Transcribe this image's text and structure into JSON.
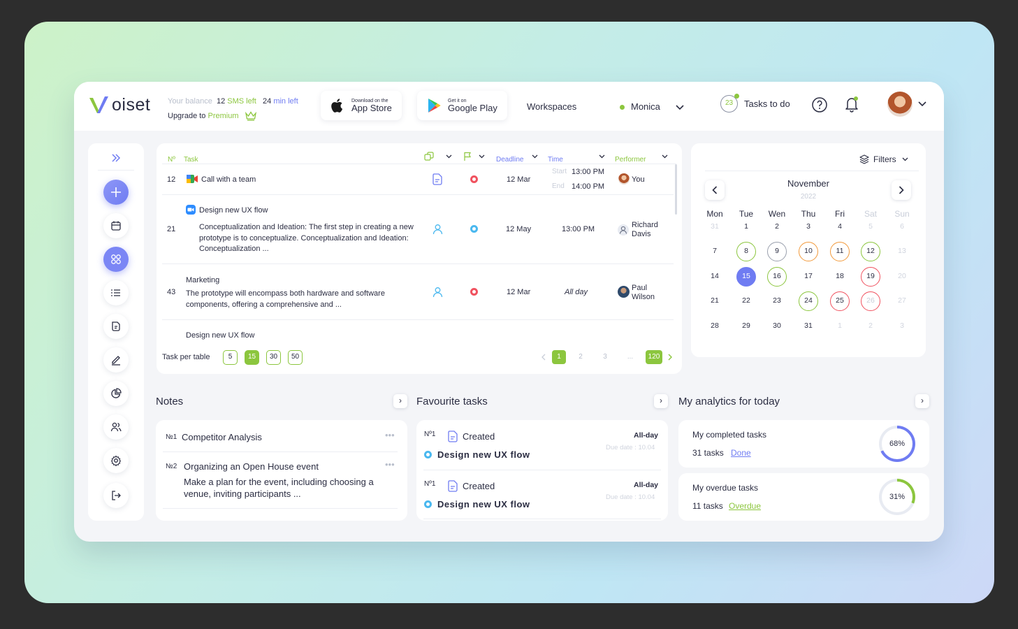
{
  "header": {
    "logo_text": "oiset",
    "balance_label": "Your balance",
    "sms_count": "12",
    "sms_label": "SMS left",
    "min_count": "24",
    "min_label": "min left",
    "upgrade_label": "Upgrade to",
    "premium_label": "Premium",
    "appstore_small": "Download on the",
    "appstore_big": "App Store",
    "googleplay_small": "Get it on",
    "googleplay_big": "Google Play",
    "workspaces_label": "Workspaces",
    "user_name": "Monica",
    "tasks_count": "23",
    "tasks_label": "Tasks to do"
  },
  "table": {
    "headers": {
      "no": "Nº",
      "task": "Task",
      "deadline": "Deadline",
      "time": "Time",
      "performer": "Performer"
    },
    "rows": [
      {
        "no": "12",
        "title": "Call with a team",
        "deadline": "12 Mar",
        "start_label": "Start",
        "start": "13:00 PM",
        "end_label": "End",
        "end": "14:00 PM",
        "performer": "You"
      },
      {
        "no": "21",
        "title": "Design new UX flow",
        "desc": "Conceptualization and Ideation: The first step in creating a new prototype is to conceptualize. Conceptualization and Ideation: Conceptualization ...",
        "deadline": "12 May",
        "time": "13:00 PM",
        "performer_first": "Richard",
        "performer_last": "Davis"
      },
      {
        "no": "43",
        "title": "Marketing",
        "desc": "The prototype will encompass both hardware and software components, offering a comprehensive and ...",
        "deadline": "12 Mar",
        "time": "All day",
        "performer_first": "Paul",
        "performer_last": "Wilson"
      },
      {
        "title": "Design new UX flow"
      }
    ],
    "per_table_label": "Task per table",
    "per_table_options": [
      "5",
      "15",
      "30",
      "50"
    ],
    "pages": [
      "1",
      "2",
      "3",
      "...",
      "120"
    ]
  },
  "calendar": {
    "filters_label": "Filters",
    "month": "November",
    "year": "2022",
    "weekdays": [
      "Mon",
      "Tue",
      "Wen",
      "Thu",
      "Fri",
      "Sat",
      "Sun"
    ],
    "days": [
      [
        "31",
        "1",
        "2",
        "3",
        "4",
        "5",
        "6"
      ],
      [
        "7",
        "8",
        "9",
        "10",
        "11",
        "12",
        "13"
      ],
      [
        "14",
        "15",
        "16",
        "17",
        "18",
        "19",
        "20"
      ],
      [
        "21",
        "22",
        "23",
        "24",
        "25",
        "26",
        "27"
      ],
      [
        "28",
        "29",
        "30",
        "31",
        "1",
        "2",
        "3"
      ]
    ]
  },
  "notes": {
    "title": "Notes",
    "items": [
      {
        "no": "№1",
        "title": "Competitor Analysis"
      },
      {
        "no": "№2",
        "title": "Organizing an Open House event",
        "desc": "Make a plan for the event, including choosing a venue, inviting participants ..."
      }
    ]
  },
  "favourites": {
    "title": "Favourite tasks",
    "items": [
      {
        "no": "Nº1",
        "status": "Created",
        "when": "All-day",
        "due": "Due date : 10.04",
        "task": "Design new UX flow"
      },
      {
        "no": "Nº1",
        "status": "Created",
        "when": "All-day",
        "due": "Due date : 10.04",
        "task": "Design new UX flow"
      }
    ]
  },
  "analytics": {
    "title": "My analytics for today",
    "completed": {
      "label": "My completed tasks",
      "count": "31 tasks",
      "link": "Done",
      "percent_label": "68%",
      "percent": 68
    },
    "overdue": {
      "label": "My overdue tasks",
      "count": "11 tasks",
      "link": "Overdue",
      "percent_label": "31%",
      "percent": 31
    }
  },
  "colors": {
    "green": "#8cc63e",
    "blue": "#6f7cf2",
    "red": "#f0525f",
    "orange": "#f29a3c",
    "sky": "#4ab8ef"
  }
}
